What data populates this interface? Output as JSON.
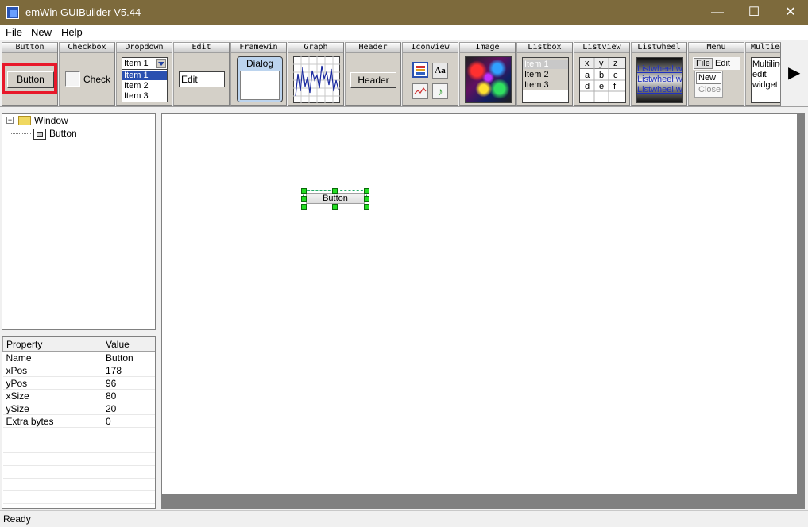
{
  "window": {
    "title": "emWin GUIBuilder V5.44",
    "minimize": "—",
    "maximize": "☐",
    "close": "✕"
  },
  "menu": [
    "File",
    "New",
    "Help"
  ],
  "toolbar": {
    "button": {
      "header": "Button",
      "label": "Button"
    },
    "checkbox": {
      "header": "Checkbox",
      "label": "Check"
    },
    "dropdown": {
      "header": "Dropdown",
      "selected": "Item 1",
      "items": [
        "Item 1",
        "Item 2",
        "Item 3"
      ]
    },
    "edit": {
      "header": "Edit",
      "value": "Edit"
    },
    "framewin": {
      "header": "Framewin",
      "caption": "Dialog"
    },
    "graph": {
      "header": "Graph"
    },
    "headerw": {
      "header": "Header",
      "label": "Header"
    },
    "iconview": {
      "header": "Iconview",
      "text_icon": "Aa"
    },
    "image": {
      "header": "Image"
    },
    "listbox": {
      "header": "Listbox",
      "items": [
        "Item 1",
        "Item 2",
        "Item 3"
      ]
    },
    "listview": {
      "header": "Listview",
      "cols": [
        "x",
        "y",
        "z"
      ],
      "rows": [
        [
          "a",
          "b",
          "c"
        ],
        [
          "d",
          "e",
          "f"
        ]
      ]
    },
    "listwheel": {
      "header": "Listwheel",
      "items": [
        "Listwheel wi",
        "Listwheel wi",
        "Listwheel wi"
      ]
    },
    "menuw": {
      "header": "Menu",
      "items": [
        "File",
        "Edit"
      ],
      "sub": [
        "New",
        "Close"
      ]
    },
    "multiedit": {
      "header": "Multiedit",
      "lines": [
        "Multiline",
        "edit",
        "widget"
      ]
    },
    "scroll_arrow": "▶"
  },
  "tree": {
    "root": "Window",
    "child": "Button"
  },
  "properties": {
    "headers": [
      "Property",
      "Value"
    ],
    "rows": [
      [
        "Name",
        "Button"
      ],
      [
        "xPos",
        "178"
      ],
      [
        "yPos",
        "96"
      ],
      [
        "xSize",
        "80"
      ],
      [
        "ySize",
        "20"
      ],
      [
        "Extra bytes",
        "0"
      ]
    ]
  },
  "canvas": {
    "widget_label": "Button"
  },
  "status": "Ready",
  "colors": {
    "title_bar": "#7d6a3c",
    "selection_red": "#e8182a",
    "handle_green": "#22dd22",
    "graph_line": "#1a2aa0"
  }
}
